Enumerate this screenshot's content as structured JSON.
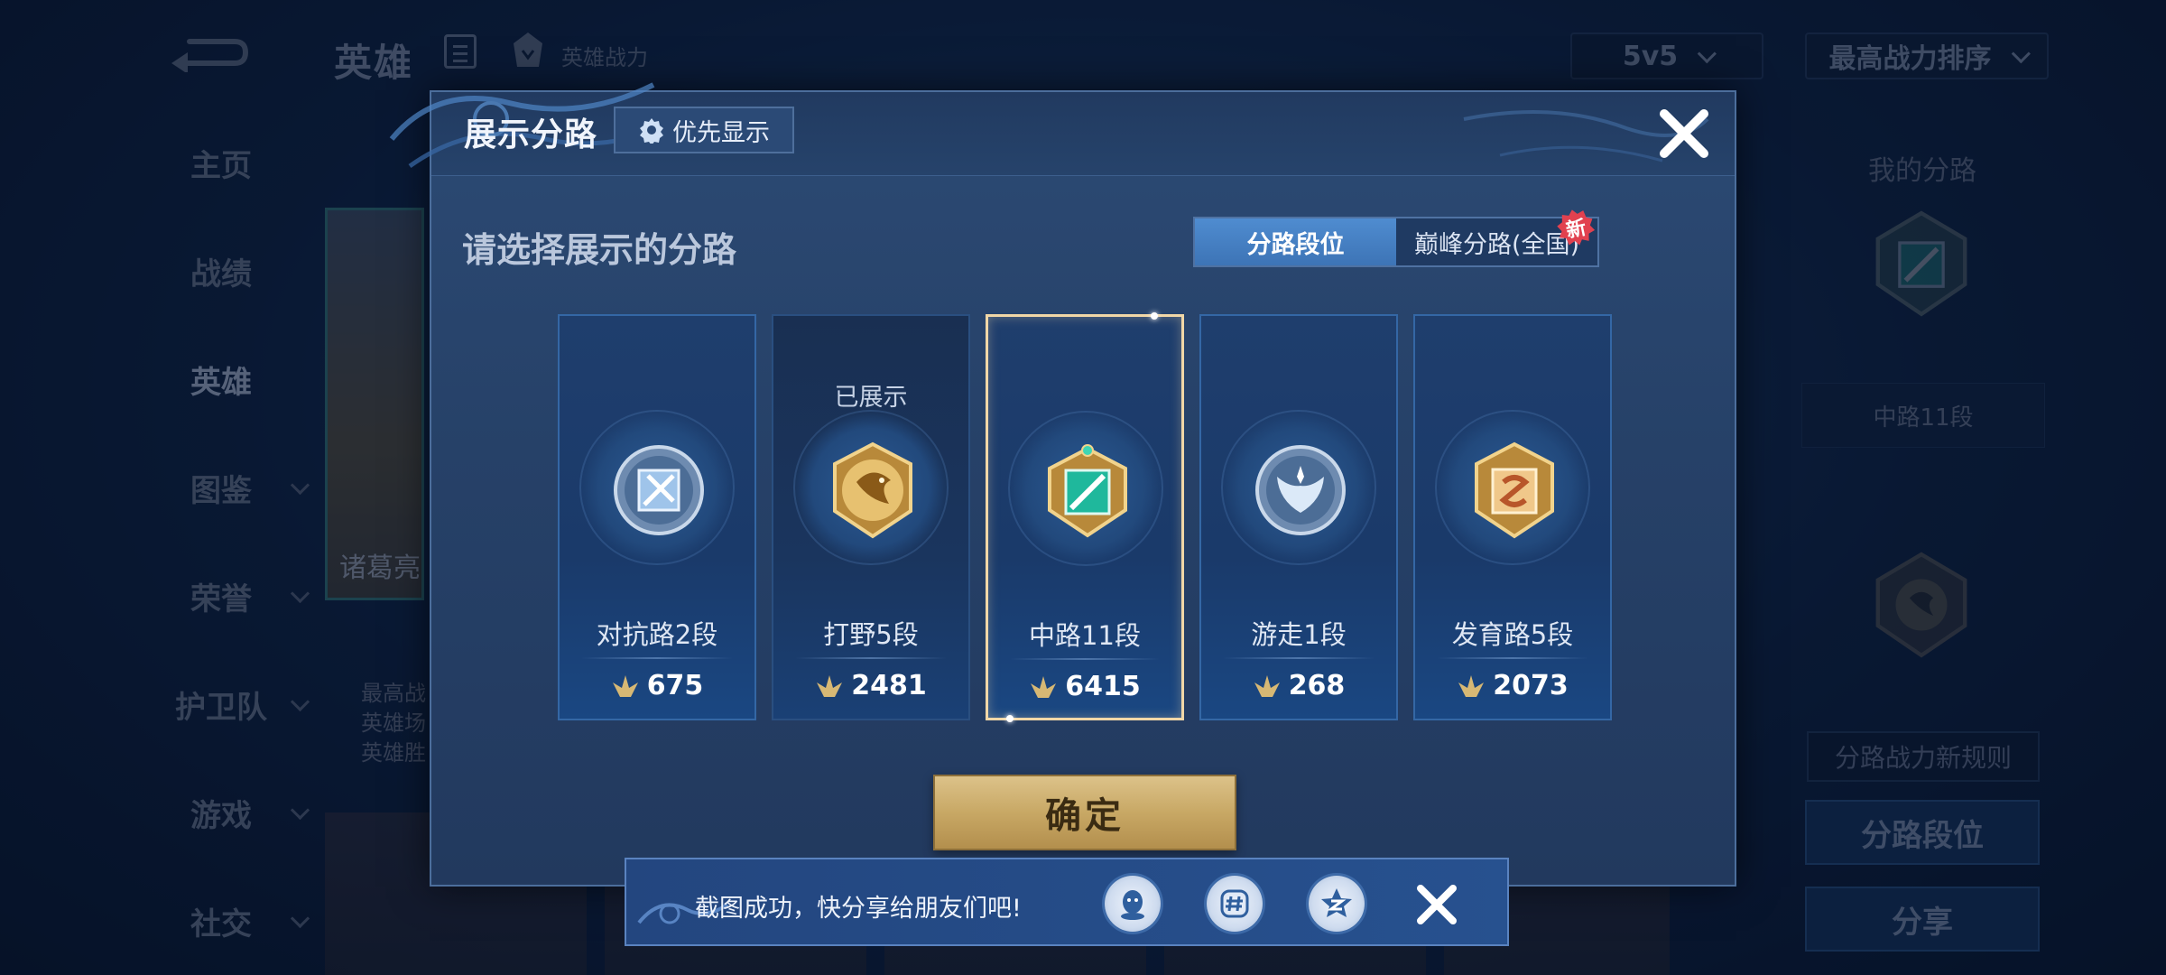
{
  "background": {
    "page_title": "英雄",
    "power_label": "英雄战力",
    "mode_select": "5v5",
    "sort_select": "最高战力排序",
    "nav": [
      {
        "label": "主页",
        "has_chevron": false,
        "active": false
      },
      {
        "label": "战绩",
        "has_chevron": false,
        "active": false
      },
      {
        "label": "英雄",
        "has_chevron": false,
        "active": true
      },
      {
        "label": "图鉴",
        "has_chevron": true,
        "active": false
      },
      {
        "label": "荣誉",
        "has_chevron": true,
        "active": false
      },
      {
        "label": "护卫队",
        "has_chevron": true,
        "active": false
      },
      {
        "label": "游戏",
        "has_chevron": true,
        "active": false
      },
      {
        "label": "社交",
        "has_chevron": true,
        "active": false
      }
    ],
    "hero_name": "诸葛亮",
    "hero_stats": [
      "最高战",
      "英雄场",
      "英雄胜"
    ],
    "right_panel": {
      "my_lane_title": "我的分路",
      "lane_label": "中路11段",
      "rule_label": "分路战力新规则",
      "lane_rank_button": "分路段位",
      "share_button": "分享"
    }
  },
  "modal": {
    "title": "展示分路",
    "priority_button": "优先显示",
    "prompt": "请选择展示的分路",
    "toggle": {
      "left": "分路段位",
      "right": "巅峰分路(全国)",
      "new_tag": "新",
      "active": "left"
    },
    "lanes": [
      {
        "name": "对抗路2段",
        "score": "675",
        "status": "",
        "selected": false,
        "badge": "clash-lane",
        "tier": "silver"
      },
      {
        "name": "打野5段",
        "score": "2481",
        "status": "已展示",
        "selected": false,
        "badge": "jungle",
        "tier": "gold"
      },
      {
        "name": "中路11段",
        "score": "6415",
        "status": "",
        "selected": true,
        "badge": "mid-lane",
        "tier": "jade"
      },
      {
        "name": "游走1段",
        "score": "268",
        "status": "",
        "selected": false,
        "badge": "roam",
        "tier": "silver"
      },
      {
        "name": "发育路5段",
        "score": "2073",
        "status": "",
        "selected": false,
        "badge": "farm-lane",
        "tier": "gold"
      }
    ],
    "confirm": "确定"
  },
  "toast": {
    "message": "截图成功，快分享给朋友们吧!",
    "share_targets": [
      "qq-icon",
      "hashtag-icon",
      "qzone-icon"
    ]
  },
  "colors": {
    "modal_bg": "#264168",
    "accent_blue": "#4f8cd0",
    "selected_border": "#f1d7a7",
    "confirm_gold": "#c8a865",
    "new_tag_red": "#e1414f"
  }
}
